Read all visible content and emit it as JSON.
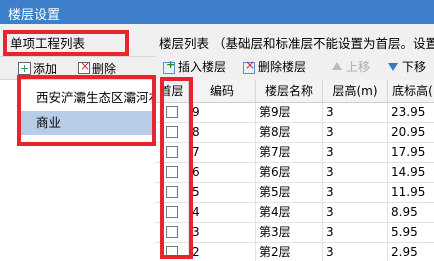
{
  "window": {
    "title": "楼层设置"
  },
  "left_panel": {
    "heading": "单项工程列表",
    "toolbar": {
      "add": "添加",
      "delete": "删除"
    },
    "projects": [
      {
        "label": "西安浐灞生态区灞河右",
        "selected": false
      },
      {
        "label": "商业",
        "selected": true
      }
    ]
  },
  "right_panel": {
    "heading": "楼层列表 （基础层和标准层不能设置为首层。设置首",
    "toolbar": {
      "insert": "插入楼层",
      "remove": "删除楼层",
      "move_up": "上移",
      "move_down": "下移"
    },
    "columns": [
      "首层",
      "编码",
      "楼层名称",
      "层高(m)",
      "底标高("
    ],
    "rows": [
      {
        "checked": false,
        "code": "9",
        "name": "第9层",
        "height": "3",
        "elevation": "23.95"
      },
      {
        "checked": false,
        "code": "8",
        "name": "第8层",
        "height": "3",
        "elevation": "20.95"
      },
      {
        "checked": false,
        "code": "7",
        "name": "第7层",
        "height": "3",
        "elevation": "17.95"
      },
      {
        "checked": false,
        "code": "6",
        "name": "第6层",
        "height": "3",
        "elevation": "14.95"
      },
      {
        "checked": false,
        "code": "5",
        "name": "第5层",
        "height": "3",
        "elevation": "11.95"
      },
      {
        "checked": false,
        "code": "4",
        "name": "第4层",
        "height": "3",
        "elevation": "8.95"
      },
      {
        "checked": false,
        "code": "3",
        "name": "第3层",
        "height": "3",
        "elevation": "5.95"
      },
      {
        "checked": false,
        "code": "2",
        "name": "第2层",
        "height": "3",
        "elevation": "2.95"
      }
    ]
  },
  "colors": {
    "titlebar": "#3d7fcb",
    "selection": "#b7cde8",
    "highlight_box": "#e8242d"
  }
}
